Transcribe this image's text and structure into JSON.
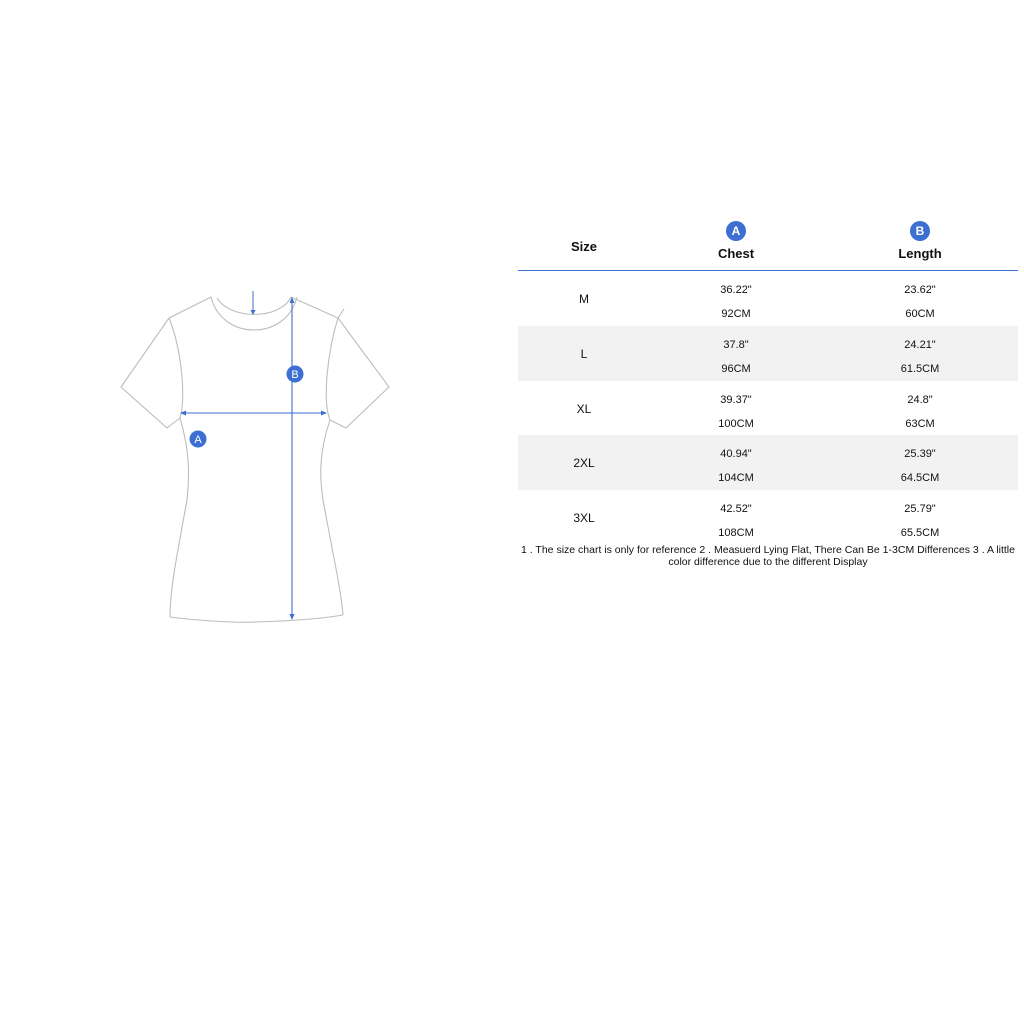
{
  "diagram": {
    "marker_chest": "A",
    "marker_length": "B"
  },
  "table": {
    "headers": {
      "size": "Size",
      "chest_badge": "A",
      "chest": "Chest",
      "length_badge": "B",
      "length": "Length"
    },
    "rows": [
      {
        "size": "M",
        "chest_in": "36.22\"",
        "chest_cm": "92CM",
        "length_in": "23.62\"",
        "length_cm": "60CM"
      },
      {
        "size": "L",
        "chest_in": "37.8\"",
        "chest_cm": "96CM",
        "length_in": "24.21\"",
        "length_cm": "61.5CM"
      },
      {
        "size": "XL",
        "chest_in": "39.37\"",
        "chest_cm": "100CM",
        "length_in": "24.8\"",
        "length_cm": "63CM"
      },
      {
        "size": "2XL",
        "chest_in": "40.94\"",
        "chest_cm": "104CM",
        "length_in": "25.39\"",
        "length_cm": "64.5CM"
      },
      {
        "size": "3XL",
        "chest_in": "42.52\"",
        "chest_cm": "108CM",
        "length_in": "25.79\"",
        "length_cm": "65.5CM"
      }
    ]
  },
  "notes": "1 . The size chart is only for reference 2 . Measuerd Lying Flat, There Can Be 1-3CM Differences 3 . A little color difference due to the different Display",
  "colors": {
    "accent": "#3c6fd1",
    "outline": "#bdbdbd",
    "row_shade": "#f2f2f2"
  }
}
